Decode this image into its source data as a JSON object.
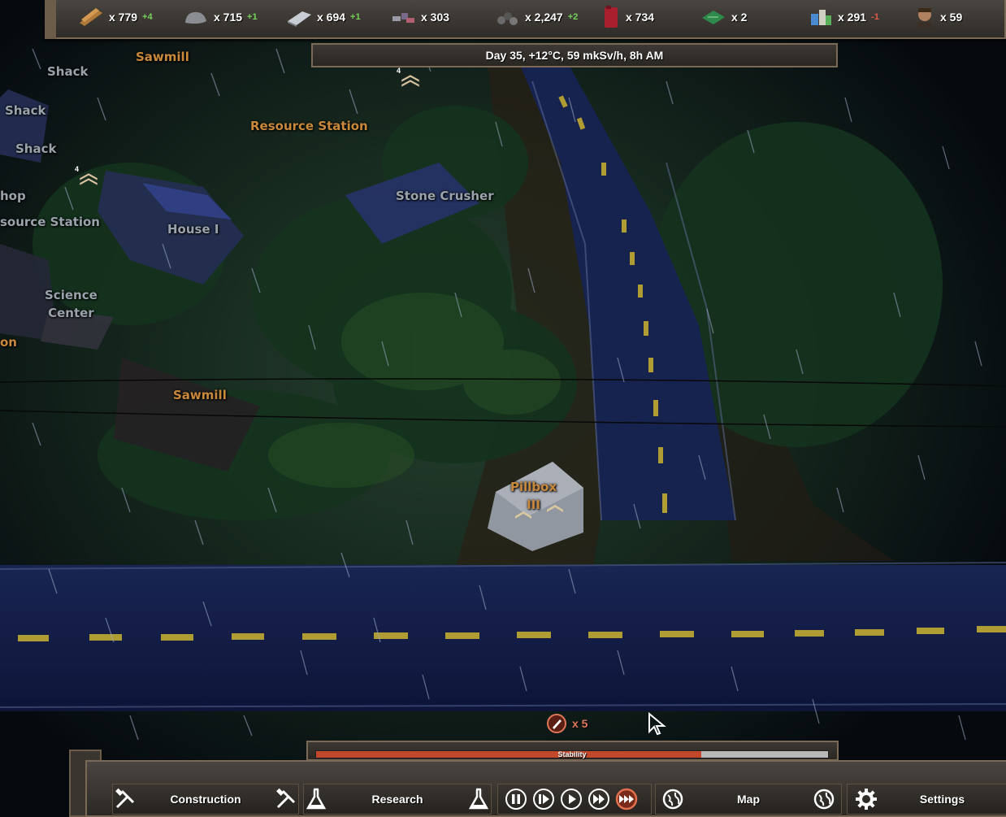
{
  "resources": [
    {
      "icon": "wood-planks-icon",
      "amount": "x 779",
      "delta": "+4",
      "sign": "pos"
    },
    {
      "icon": "stone-icon",
      "amount": "x 715",
      "delta": "+1",
      "sign": "pos"
    },
    {
      "icon": "metal-plate-icon",
      "amount": "x 694",
      "delta": "+1",
      "sign": "pos"
    },
    {
      "icon": "scrap-parts-icon",
      "amount": "x 303",
      "delta": "",
      "sign": "none"
    },
    {
      "icon": "ore-pile-icon",
      "amount": "x 2,247",
      "delta": "+2",
      "sign": "pos"
    },
    {
      "icon": "fuel-canister-icon",
      "amount": "x 734",
      "delta": "",
      "sign": "none"
    },
    {
      "icon": "circuit-board-icon",
      "amount": "x 2",
      "delta": "",
      "sign": "none"
    },
    {
      "icon": "food-supplies-icon",
      "amount": "x 291",
      "delta": "-1",
      "sign": "neg"
    },
    {
      "icon": "survivor-portrait-icon",
      "amount": "x 59",
      "delta": "",
      "sign": "none"
    }
  ],
  "status_line": "Day 35, +12°C, 59 mkSv/h, 8h AM",
  "map_labels": {
    "sawmill_top": "Sawmill",
    "shack_1": "Shack",
    "shack_2": "Shack",
    "shack_3": "Shack",
    "resource_station": "Resource Station",
    "shop_partial": "hop",
    "resource_station_partial": "source Station",
    "house": "House I",
    "stone_crusher": "Stone Crusher",
    "science_center": "Science\nCenter",
    "partial_on": "on",
    "sawmill_bottom": "Sawmill",
    "pillbox": "Pillbox\nIII"
  },
  "rank_numbers": {
    "rank_a": "4",
    "rank_b": "4"
  },
  "alert": {
    "icon": "raider-alert-icon",
    "count": "x 5"
  },
  "stability": {
    "label": "Stability",
    "value": 0.752,
    "fill_color": "#c3482a"
  },
  "bottom_menu": {
    "construction": "Construction",
    "research": "Research",
    "map": "Map",
    "settings": "Settings"
  },
  "speed_controls": [
    "pause",
    "step",
    "play",
    "fast-forward",
    "fastest"
  ],
  "active_speed": "fastest",
  "colors": {
    "accent_orange": "#c9893c",
    "label_gray": "#9aa3ab",
    "frame": "#7a6a55"
  }
}
